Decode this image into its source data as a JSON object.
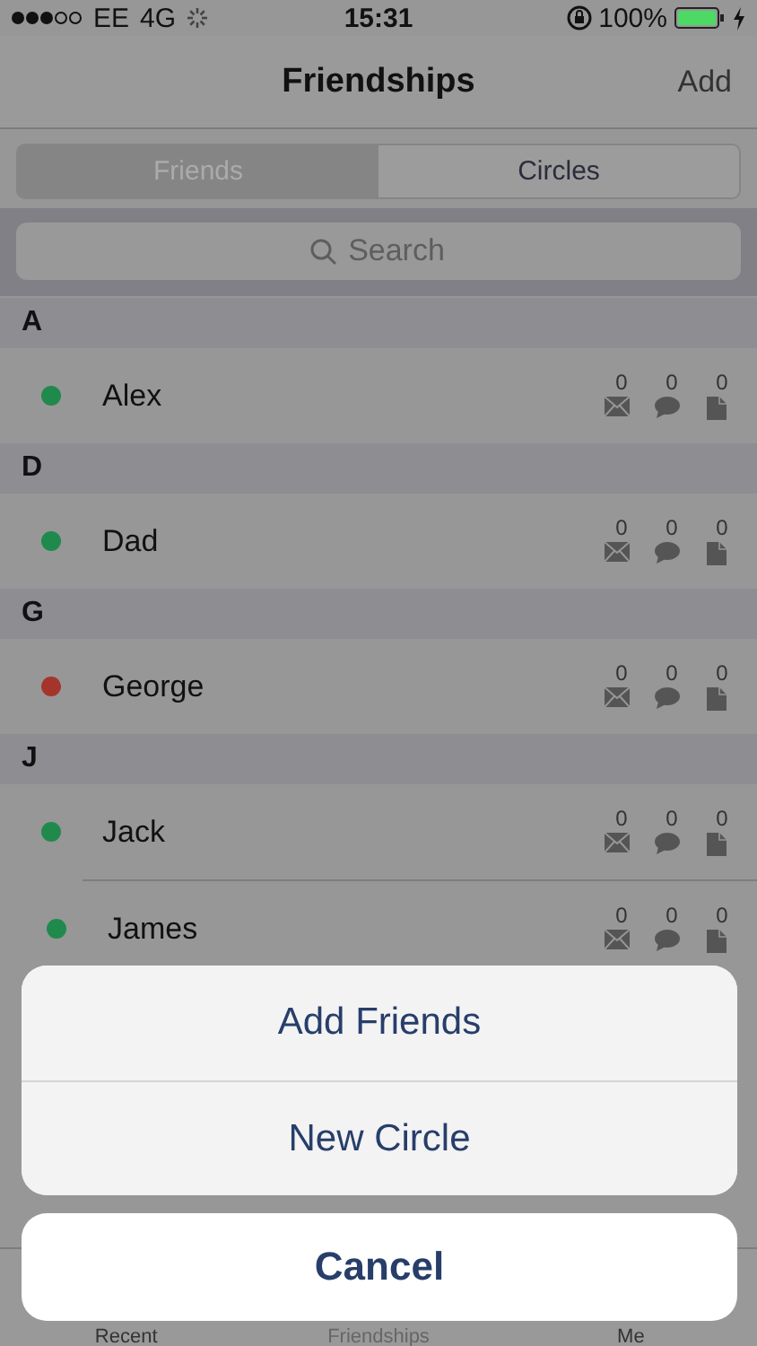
{
  "status_bar": {
    "carrier": "EE",
    "network": "4G",
    "time": "15:31",
    "battery": "100%"
  },
  "nav_bar": {
    "title": "Friendships",
    "action": "Add"
  },
  "segments": [
    {
      "label": "Friends",
      "selected": true
    },
    {
      "label": "Circles",
      "selected": false
    }
  ],
  "search": {
    "placeholder": "Search"
  },
  "sections": [
    {
      "letter": "A",
      "friends": [
        {
          "name": "Alex",
          "color": "#1f8a4c",
          "counters": [
            {
              "kind": "mail",
              "count": "0"
            },
            {
              "kind": "chat",
              "count": "0"
            },
            {
              "kind": "file",
              "count": "0"
            }
          ]
        }
      ]
    },
    {
      "letter": "D",
      "friends": [
        {
          "name": "Dad",
          "color": "#1f8a4c",
          "counters": [
            {
              "kind": "mail",
              "count": "0"
            },
            {
              "kind": "chat",
              "count": "0"
            },
            {
              "kind": "file",
              "count": "0"
            }
          ]
        }
      ]
    },
    {
      "letter": "G",
      "friends": [
        {
          "name": "George",
          "color": "#a5352b",
          "counters": [
            {
              "kind": "mail",
              "count": "0"
            },
            {
              "kind": "chat",
              "count": "0"
            },
            {
              "kind": "file",
              "count": "0"
            }
          ]
        }
      ]
    },
    {
      "letter": "J",
      "friends": [
        {
          "name": "Jack",
          "color": "#1f8a4c",
          "counters": [
            {
              "kind": "mail",
              "count": "0"
            },
            {
              "kind": "chat",
              "count": "0"
            },
            {
              "kind": "file",
              "count": "0"
            }
          ]
        },
        {
          "name": "James",
          "color": "#1f8a4c",
          "counters": [
            {
              "kind": "mail",
              "count": "0"
            },
            {
              "kind": "chat",
              "count": "0"
            },
            {
              "kind": "file",
              "count": "0"
            }
          ]
        }
      ]
    }
  ],
  "tab_bar": [
    {
      "label": "Recent",
      "selected": false
    },
    {
      "label": "Friendships",
      "selected": true
    },
    {
      "label": "Me",
      "selected": false
    }
  ],
  "action_sheet": {
    "options": [
      "Add Friends",
      "New Circle"
    ],
    "cancel": "Cancel"
  }
}
